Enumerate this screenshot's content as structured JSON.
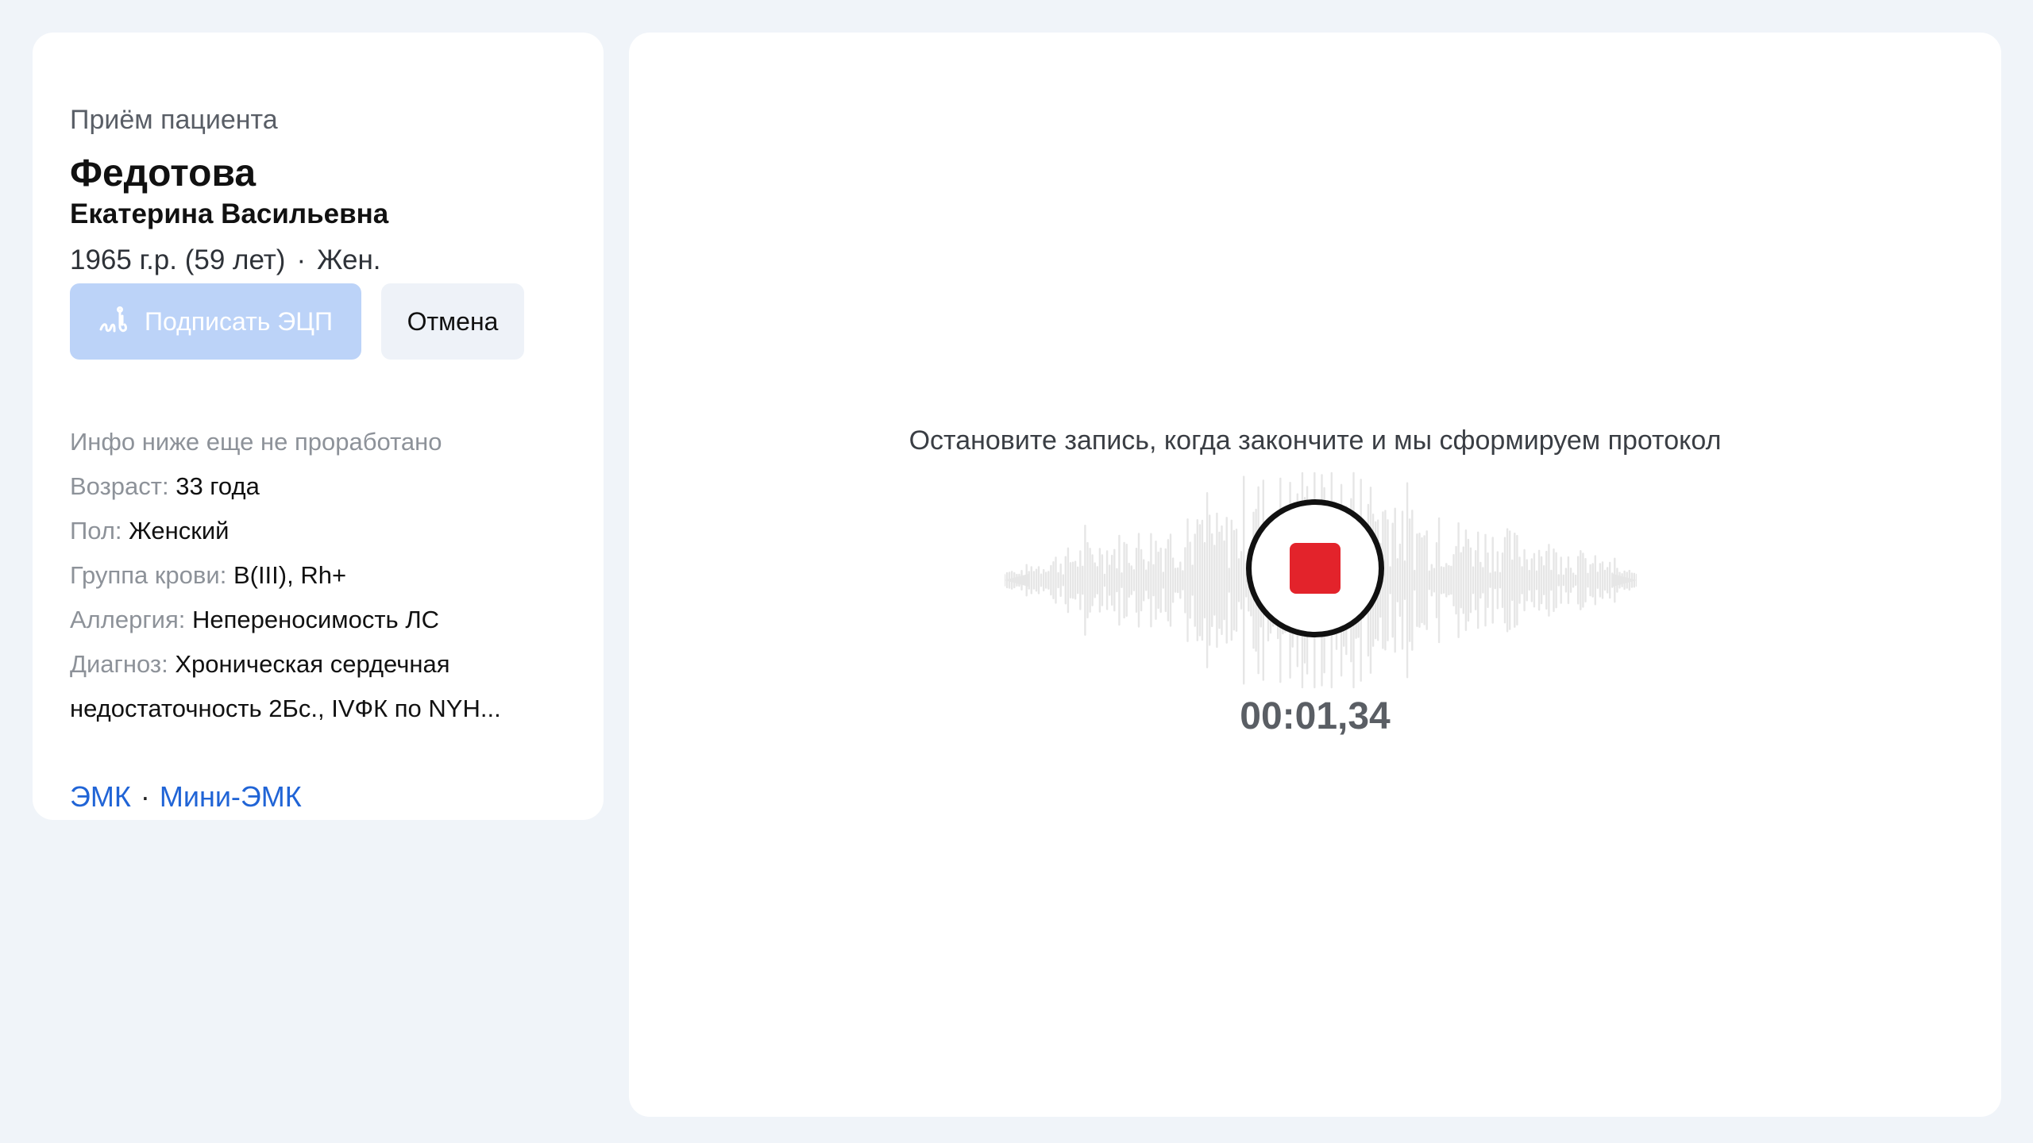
{
  "patient": {
    "caption": "Приём пациента",
    "surname": "Федотова",
    "given_names": "Екатерина Васильевна",
    "birth": "1965 г.р. (59 лет)",
    "separator": "·",
    "sex_short": "Жен."
  },
  "actions": {
    "sign_label": "Подписать ЭЦП",
    "cancel_label": "Отмена"
  },
  "info": {
    "note": "Инфо ниже еще не проработано",
    "rows": [
      {
        "label": "Возраст:",
        "value": "33 года"
      },
      {
        "label": "Пол:",
        "value": "Женский"
      },
      {
        "label": "Группа крови:",
        "value": "B(III), Rh+"
      },
      {
        "label": "Аллергия:",
        "value": "Непереносимость ЛС"
      },
      {
        "label": "Диагноз:",
        "value": "Хроническая сердечная недостаточность 2Бс., IVФК по NYH..."
      }
    ]
  },
  "links": {
    "emk": "ЭМК",
    "separator": "·",
    "mini_emk": "Мини-ЭМК"
  },
  "recording": {
    "hint": "Остановите запись, когда закончите и мы сформируем протокол",
    "timer": "00:01,34",
    "stop_color": "#e3232b"
  },
  "colors": {
    "background": "#f0f4f9",
    "link": "#2064d6",
    "sign_button_disabled": "#bcd3f8",
    "waveform": "#e6e6e6"
  }
}
